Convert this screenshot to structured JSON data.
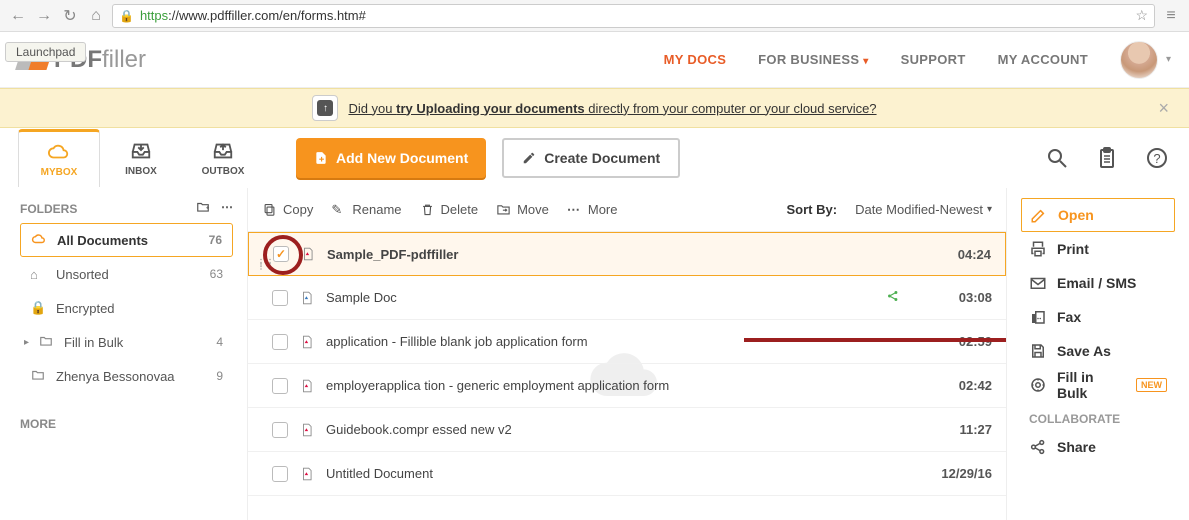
{
  "browser": {
    "url_secure": "https",
    "url_rest": "://www.pdffiller.com/en/forms.htm#",
    "launchpad": "Launchpad"
  },
  "header": {
    "logo_bold": "PDF",
    "logo_light": "filler",
    "nav": {
      "mydocs": "MY DOCS",
      "business": "FOR BUSINESS",
      "support": "SUPPORT",
      "account": "MY ACCOUNT"
    }
  },
  "banner": {
    "pre": "Did you ",
    "bold": "try Uploading your documents",
    "post": " directly from your computer or your cloud service?"
  },
  "tabs": {
    "mybox": "MYBOX",
    "inbox": "INBOX",
    "outbox": "OUTBOX"
  },
  "buttons": {
    "add": "Add New Document",
    "create": "Create Document"
  },
  "sidebar": {
    "folders_title": "FOLDERS",
    "items": [
      {
        "label": "All Documents",
        "count": "76"
      },
      {
        "label": "Unsorted",
        "count": "63"
      },
      {
        "label": "Encrypted",
        "count": ""
      },
      {
        "label": "Fill in Bulk",
        "count": "4"
      },
      {
        "label": "Zhenya Bessonovaa",
        "count": "9"
      }
    ],
    "more_title": "MORE"
  },
  "actions": {
    "copy": "Copy",
    "rename": "Rename",
    "delete": "Delete",
    "move": "Move",
    "more": "More",
    "sort_label": "Sort By:",
    "sort_value": "Date Modified-Newest"
  },
  "docs": [
    {
      "name": "Sample_PDF-pdffiller",
      "time": "04:24",
      "selected": true
    },
    {
      "name": "Sample Doc",
      "time": "03:08",
      "share": true
    },
    {
      "name": "application - Fillible blank job application form",
      "time": "02:59",
      "arrow": true
    },
    {
      "name": "employerapplica tion - generic employment application form",
      "time": "02:42"
    },
    {
      "name": "Guidebook.compr essed new v2",
      "time": "11:27"
    },
    {
      "name": "Untitled Document",
      "time": "12/29/16"
    }
  ],
  "right": {
    "open": "Open",
    "print": "Print",
    "email": "Email / SMS",
    "fax": "Fax",
    "saveas": "Save As",
    "fillbulk": "Fill in Bulk",
    "new_badge": "NEW",
    "collaborate": "COLLABORATE",
    "share": "Share"
  }
}
